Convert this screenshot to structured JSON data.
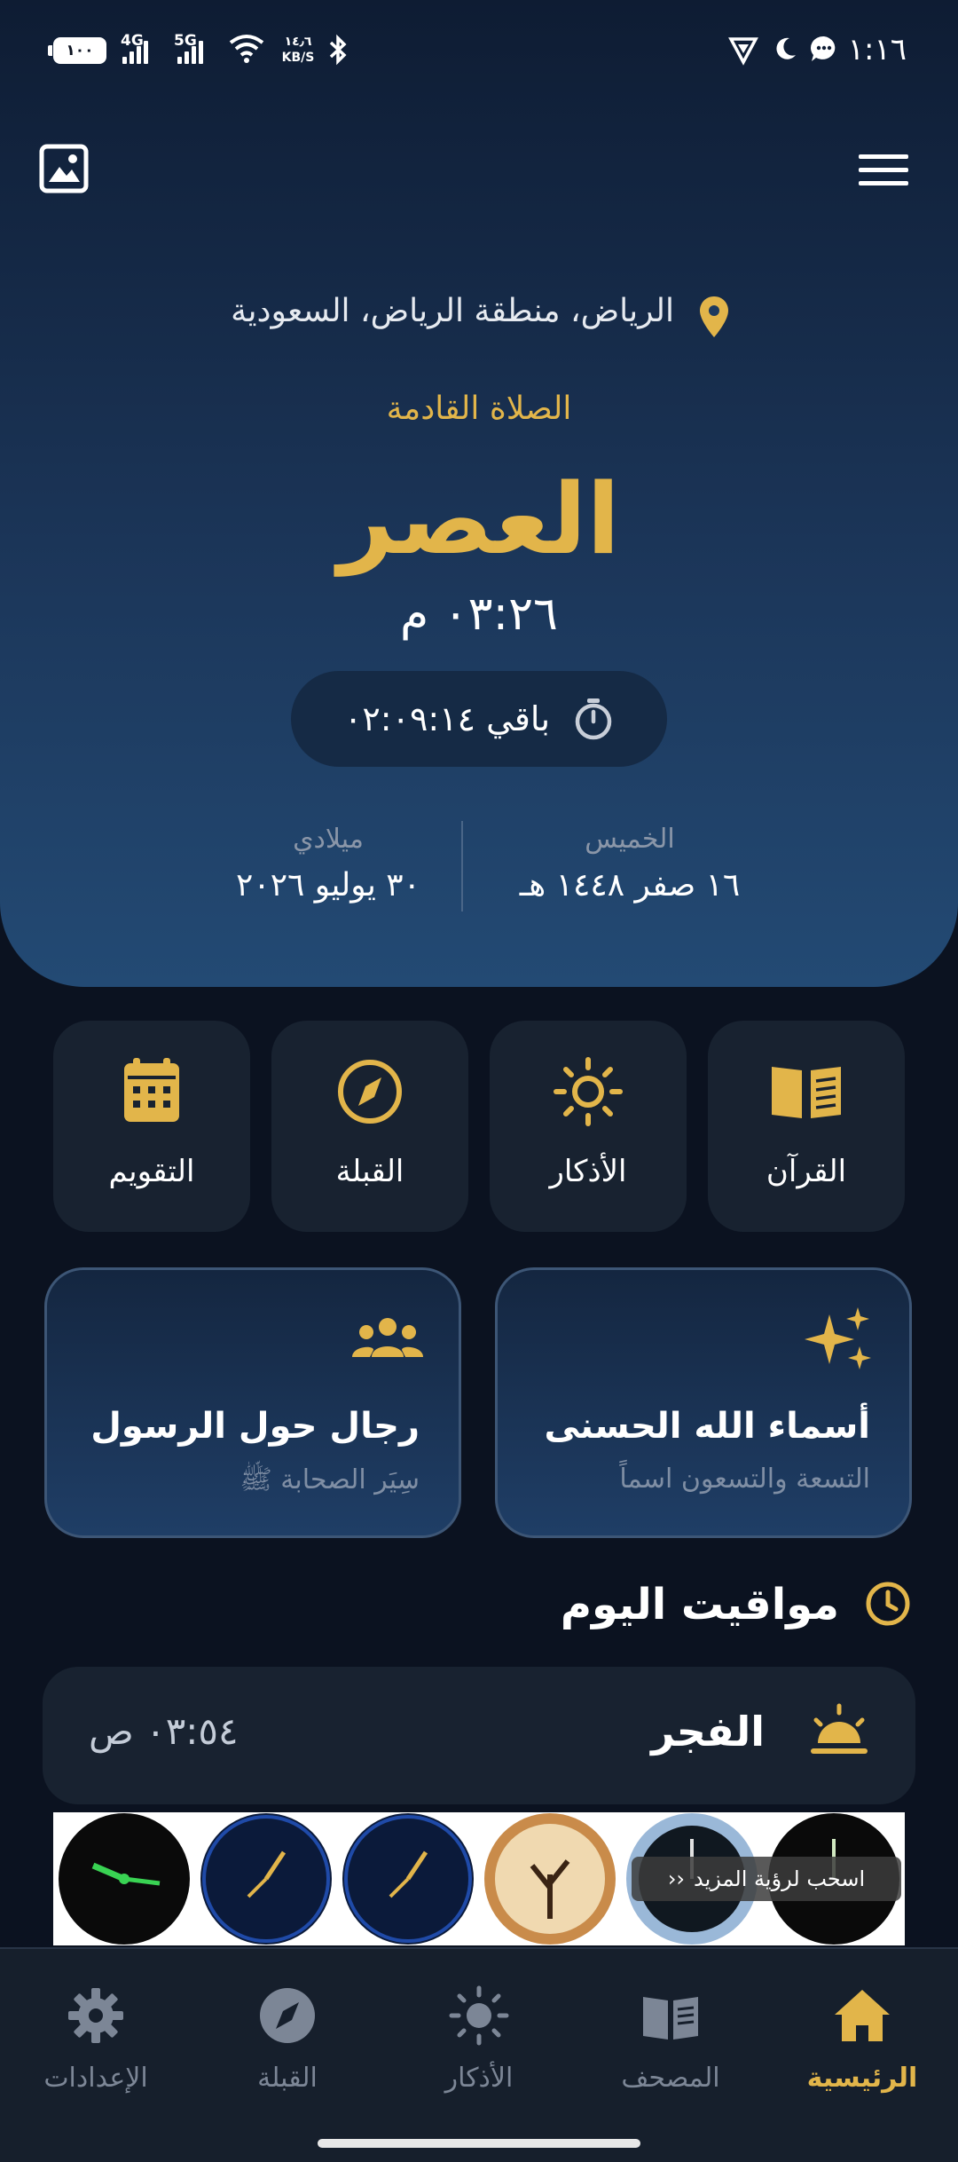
{
  "status_bar": {
    "battery": "١٠٠",
    "network_4g": "4G",
    "network_5g": "5G",
    "speed_value": "١٤٫٦",
    "speed_unit": "KB/S",
    "time": "١:١٦"
  },
  "header": {
    "location": "الرياض، منطقة الرياض، السعودية",
    "next_prayer_label": "الصلاة القادمة",
    "next_prayer_name": "العصر",
    "next_prayer_time": "٠٣:٢٦ م",
    "countdown": "باقي ٠٢:٠٩:١٤",
    "hijri": {
      "label": "الخميس",
      "value": "١٦ صفر ١٤٤٨ هـ"
    },
    "gregorian": {
      "label": "ميلادي",
      "value": "٣٠ يوليو ٢٠٢٦"
    }
  },
  "quick_tiles": [
    {
      "label": "القرآن",
      "icon": "book-open-icon"
    },
    {
      "label": "الأذكار",
      "icon": "sun-icon"
    },
    {
      "label": "القبلة",
      "icon": "compass-icon"
    },
    {
      "label": "التقويم",
      "icon": "calendar-icon"
    }
  ],
  "feature_cards": [
    {
      "title": "أسماء الله الحسنى",
      "subtitle": "التسعة والتسعون اسماً",
      "icon": "sparkles-icon"
    },
    {
      "title": "رجال حول الرسول",
      "subtitle": "سِيَر الصحابة ﷺ",
      "icon": "users-icon"
    }
  ],
  "today_section": {
    "title": "مواقيت اليوم",
    "prayers": [
      {
        "name": "الفجر",
        "time": "٠٣:٥٤ ص",
        "icon": "sunrise-icon"
      }
    ]
  },
  "ad": {
    "overlay_text": "اسحب لرؤية المزيد"
  },
  "bottom_nav": [
    {
      "label": "الرئيسية",
      "icon": "home-icon",
      "active": true
    },
    {
      "label": "المصحف",
      "icon": "mushaf-icon",
      "active": false
    },
    {
      "label": "الأذكار",
      "icon": "sun-icon",
      "active": false
    },
    {
      "label": "القبلة",
      "icon": "compass-icon",
      "active": false
    },
    {
      "label": "الإعدادات",
      "icon": "gear-icon",
      "active": false
    }
  ],
  "colors": {
    "accent": "#e2b54a",
    "background": "#0b1220",
    "hero_top": "#0e1c33",
    "hero_bottom": "#234a74",
    "tile_bg": "#182230"
  }
}
